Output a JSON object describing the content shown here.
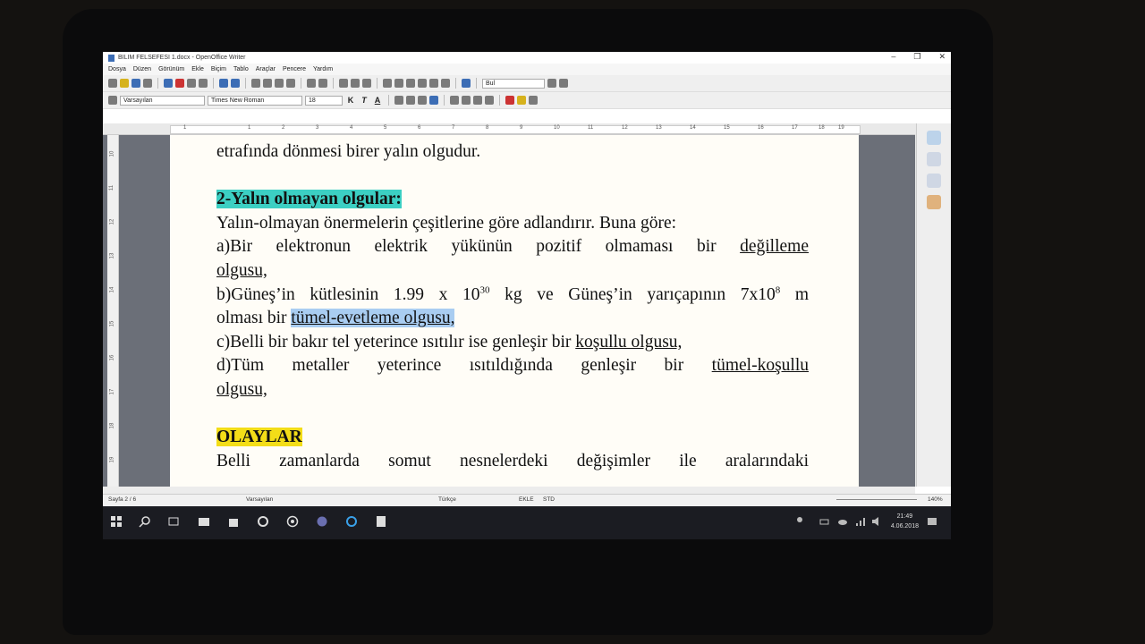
{
  "window": {
    "title": "BILIM FELSEFESI 1.docx - OpenOffice Writer",
    "minimize": "–",
    "maximize": "❐",
    "close": "✕"
  },
  "menu": [
    "Dosya",
    "Düzen",
    "Görünüm",
    "Ekle",
    "Biçim",
    "Tablo",
    "Araçlar",
    "Pencere",
    "Yardım"
  ],
  "toolbar": {
    "find_value": "Bul"
  },
  "format_toolbar": {
    "style": "Varsayılan",
    "font": "Times New Roman",
    "size": "18",
    "bold": "K",
    "italic": "T",
    "underline": "A"
  },
  "ruler": {
    "marks": [
      "1",
      "1",
      "2",
      "3",
      "4",
      "5",
      "6",
      "7",
      "8",
      "9",
      "10",
      "11",
      "12",
      "13",
      "14",
      "15",
      "16",
      "17",
      "18",
      "19"
    ]
  },
  "vruler": {
    "marks": [
      "10",
      "11",
      "12",
      "13",
      "14",
      "15",
      "16",
      "17",
      "18",
      "19"
    ]
  },
  "document": {
    "line0": "etrafında dönmesi birer yalın olgudur.",
    "heading1": "2-Yalın olmayan olgular:",
    "para1": "Yalın-olmayan önermelerin çeşitlerine göre adlandırır. Buna göre:",
    "a_text": "a)Bir elektronun elektrik yükünün pozitif olmaması bir ",
    "a_term1": "değilleme",
    "a_term2": "olgusu,",
    "b_part1": "b)Güneş’in kütlesinin 1.99 x 10",
    "b_sup1": "30",
    "b_part2": " kg ve Güneş’in yarıçapının 7x10",
    "b_sup2": "8",
    "b_part3": " m",
    "b2_text": "olması bir ",
    "b2_term": "tümel-evetleme olgusu,",
    "c_text": "c)Belli bir bakır tel yeterince ısıtılır ise genleşir bir ",
    "c_term": "koşullu olgusu,",
    "d_text": "d)Tüm metaller yeterince ısıtıldığında genleşir bir ",
    "d_term1": "tümel-koşullu",
    "d_term2": "olgusu,",
    "heading2": "OLAYLAR",
    "para2": "Belli zamanlarda somut nesnelerdeki değişimler ile aralarındaki"
  },
  "status": {
    "page": "Sayfa 2 / 6",
    "style": "Varsayılan",
    "language": "Türkçe",
    "mode1": "EKLE",
    "mode2": "STD",
    "zoom": "140%"
  },
  "tray": {
    "time": "21:49",
    "date": "4.06.2018"
  }
}
